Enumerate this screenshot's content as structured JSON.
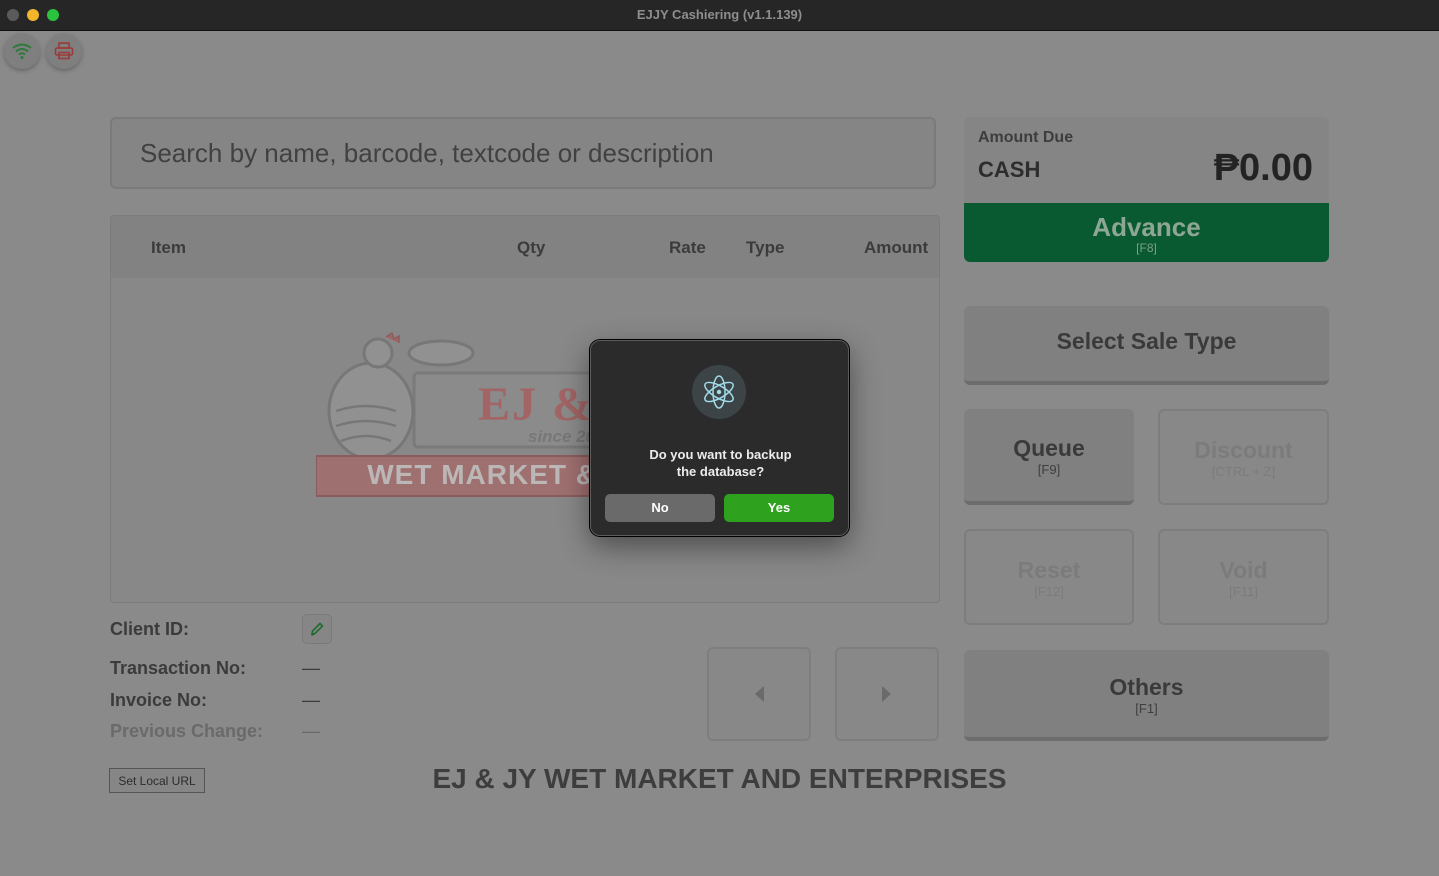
{
  "window": {
    "title": "EJJY Cashiering (v1.1.139)"
  },
  "search": {
    "placeholder": "Search by name, barcode, textcode or description"
  },
  "table": {
    "columns": [
      "Item",
      "Qty",
      "Rate",
      "Type",
      "Amount"
    ]
  },
  "logo": {
    "name": "EJ & J",
    "since": "since 2006",
    "banner": "WET MARKET & ENT"
  },
  "amount_due": {
    "label": "Amount Due",
    "payment_type": "CASH",
    "value": "₱0.00"
  },
  "buttons": {
    "advance": {
      "label": "Advance",
      "key": "[F8]"
    },
    "select_sale_type": {
      "label": "Select Sale Type"
    },
    "queue": {
      "label": "Queue",
      "key": "[F9]"
    },
    "discount": {
      "label": "Discount",
      "key": "[CTRL + Z]"
    },
    "reset": {
      "label": "Reset",
      "key": "[F12]"
    },
    "void": {
      "label": "Void",
      "key": "[F11]"
    },
    "others": {
      "label": "Others",
      "key": "[F1]"
    },
    "set_local_url": "Set Local URL"
  },
  "info": {
    "client_id": "Client ID:",
    "transaction_no": {
      "label": "Transaction No:",
      "value": "—"
    },
    "invoice_no": {
      "label": "Invoice No:",
      "value": "—"
    },
    "previous_change": {
      "label": "Previous Change:",
      "value": "—"
    }
  },
  "company_name": "EJ & JY WET MARKET AND ENTERPRISES",
  "dialog": {
    "message_line1": "Do you want to backup",
    "message_line2": "the database?",
    "no": "No",
    "yes": "Yes"
  },
  "colors": {
    "accent_green": "#0a5a31",
    "yes_button": "#2ea11f",
    "logo_red": "#c23a3a"
  },
  "icons": [
    "wifi-icon",
    "printer-icon",
    "edit-pencil-icon",
    "chevron-left-icon",
    "chevron-right-icon",
    "electron-app-icon"
  ]
}
